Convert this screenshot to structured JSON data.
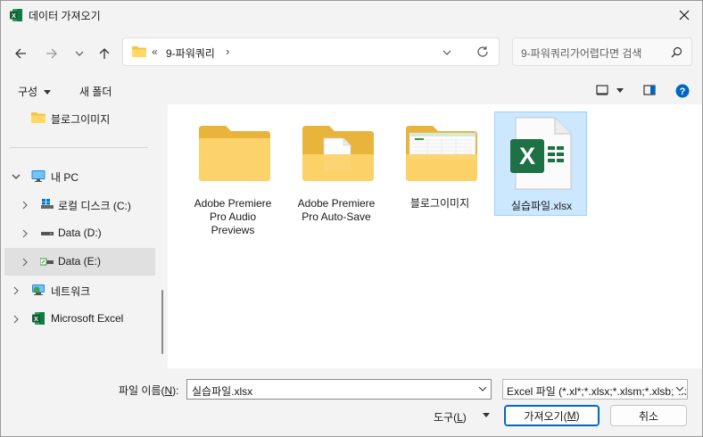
{
  "window": {
    "title": "데이터 가져오기",
    "accent": "#0067c0",
    "excel_green": "#1e7145"
  },
  "nav": {
    "back": "back",
    "forward": "forward",
    "recent": "recent-locations",
    "up": "up",
    "breadcrumb_overflow": "«",
    "breadcrumb_current": "9-파워쿼리",
    "breadcrumb_sep": "›"
  },
  "search": {
    "placeholder": "9-파워쿼리가어렵다면 검색"
  },
  "toolbar": {
    "organize": "구성",
    "new_folder": "새 폴더"
  },
  "sidebar": {
    "items": [
      {
        "label": "블로그이미지",
        "icon": "folder-icon"
      },
      {
        "label": "내 PC",
        "icon": "pc-icon"
      },
      {
        "label": "로컬 디스크 (C:)",
        "icon": "windows-drive-icon"
      },
      {
        "label": "Data (D:)",
        "icon": "drive-icon"
      },
      {
        "label": "Data (E:)",
        "icon": "usb-drive-icon"
      },
      {
        "label": "네트워크",
        "icon": "network-icon"
      },
      {
        "label": "Microsoft Excel",
        "icon": "excel-icon"
      }
    ]
  },
  "files": [
    {
      "name": "Adobe Premiere Pro Audio Previews",
      "type": "folder"
    },
    {
      "name": "Adobe Premiere Pro Auto-Save",
      "type": "folder-with-doc"
    },
    {
      "name": "블로그이미지",
      "type": "folder-with-image"
    },
    {
      "name": "실습파일.xlsx",
      "type": "excel-file"
    }
  ],
  "bottom": {
    "filename_label_pre": "파일 이름(",
    "filename_label_key": "N",
    "filename_label_post": "):",
    "filename_value": "실습파일.xlsx",
    "filetype_value": "Excel 파일 (*.xl*;*.xlsx;*.xlsm;*.xlsb;*.xlam;*.xltx;*.xltm;*.xls;*.xlt;*.htm;*.html;*.mht;*.mhtml;*.xml;*.xla;*.xlm;*.xlw;*.odc;*.ods)",
    "tools_pre": "도구(",
    "tools_key": "L",
    "tools_post": ")",
    "open_pre": "가져오기(",
    "open_key": "M",
    "open_post": ")",
    "cancel": "취소"
  }
}
